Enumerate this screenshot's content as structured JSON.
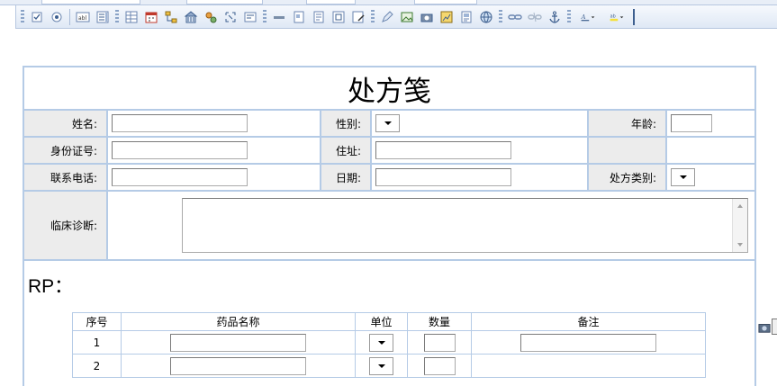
{
  "toolbar": {
    "button_labels": [
      "abl"
    ],
    "icons": [
      "checkbox-icon",
      "radio-icon",
      "textfield-icon",
      "listbox-icon",
      "table-icon",
      "calendar-icon",
      "tree-icon",
      "building-icon",
      "gears-icon",
      "select-region-icon",
      "properties-icon",
      "line-icon",
      "form-icon",
      "page-icon",
      "frame-icon",
      "edit-icon",
      "pencil-icon",
      "image-icon",
      "camera-icon",
      "chart-icon",
      "document-icon",
      "globe-icon",
      "link-icon",
      "unlink-icon",
      "anchor-icon",
      "font-color-icon",
      "highlight-icon"
    ]
  },
  "form": {
    "title": "处方笺",
    "fields": {
      "name_label": "姓名:",
      "gender_label": "性别:",
      "age_label": "年龄:",
      "id_label": "身份证号:",
      "address_label": "住址:",
      "phone_label": "联系电话:",
      "date_label": "日期:",
      "rx_type_label": "处方类别:",
      "diagnosis_label": "临床诊断:"
    },
    "rp_label": "RP："
  },
  "medicine_table": {
    "headers": [
      "序号",
      "药品名称",
      "单位",
      "数量",
      "备注"
    ],
    "rows": [
      {
        "index": "1"
      },
      {
        "index": "2"
      }
    ]
  },
  "colors": {
    "grid_border": "#b5cbe6",
    "label_bg": "#ececec",
    "toolbar_bg": "#dfe8f5"
  }
}
